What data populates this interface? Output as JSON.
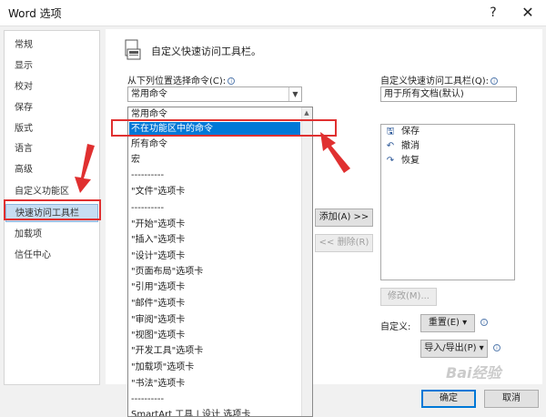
{
  "window": {
    "title": "Word 选项",
    "help_glyph": "?",
    "close_glyph": "✕"
  },
  "sidebar": {
    "items": [
      {
        "label": "常规"
      },
      {
        "label": "显示"
      },
      {
        "label": "校对"
      },
      {
        "label": "保存"
      },
      {
        "label": "版式"
      },
      {
        "label": "语言"
      },
      {
        "label": "高级"
      },
      {
        "label": "自定义功能区"
      },
      {
        "label": "快速访问工具栏",
        "selected": true
      },
      {
        "label": "加载项"
      },
      {
        "label": "信任中心"
      }
    ]
  },
  "main": {
    "header": "自定义快速访问工具栏。",
    "choose_label": "从下列位置选择命令(C):",
    "choose_value": "常用命令",
    "customize_label": "自定义快速访问工具栏(Q):",
    "customize_value": "用于所有文档(默认)",
    "dropdown_options": [
      "常用命令",
      "不在功能区中的命令",
      "所有命令",
      "宏",
      "----------",
      "\"文件\"选项卡",
      "----------",
      "\"开始\"选项卡",
      "\"插入\"选项卡",
      "\"设计\"选项卡",
      "\"页面布局\"选项卡",
      "\"引用\"选项卡",
      "\"邮件\"选项卡",
      "\"审阅\"选项卡",
      "\"视图\"选项卡",
      "\"开发工具\"选项卡",
      "\"加载项\"选项卡",
      "\"书法\"选项卡",
      "----------",
      "SmartArt 工具 | 设计 选项卡"
    ],
    "highlighted_option_index": 1,
    "add_button": "添加(A) >>",
    "remove_button": "<< 删除(R)",
    "qat_items": [
      {
        "label": "保存",
        "icon": "save-icon",
        "glyph": "🖫"
      },
      {
        "label": "撤消",
        "icon": "undo-icon",
        "glyph": "↶"
      },
      {
        "label": "恢复",
        "icon": "redo-icon",
        "glyph": "↷"
      }
    ],
    "modify_button": "修改(M)...",
    "customize_text": "自定义:",
    "reset_button": "重置(E) ▾",
    "import_export_button": "导入/导出(P) ▾",
    "ok_button": "确定",
    "cancel_button": "取消"
  },
  "watermark": "Bai经验",
  "colors": {
    "highlight": "#0078d7",
    "annotation_red": "#e03030",
    "sidebar_selected": "#c7ddf2"
  }
}
